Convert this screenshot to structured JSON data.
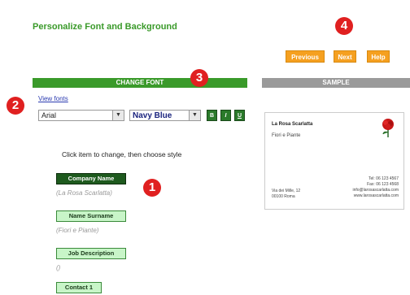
{
  "page": {
    "title": "Personalize Font and Background"
  },
  "nav": {
    "previous": "Previous",
    "next": "Next",
    "help": "Help"
  },
  "markers": {
    "one": "1",
    "two": "2",
    "three": "3",
    "four": "4"
  },
  "font_panel": {
    "header": "CHANGE FONT",
    "view_fonts": "View fonts",
    "font_value": "Arial",
    "color_value": "Navy Blue",
    "bold": "B",
    "italic": "I",
    "underline": "U",
    "instruction": "Click item to change, then choose style"
  },
  "items": [
    {
      "label": "Company Name",
      "value": "(La Rosa Scarlatta)"
    },
    {
      "label": "Name Surname",
      "value": "(Fiori e Piante)"
    },
    {
      "label": "Job Description",
      "value": "()"
    },
    {
      "label": "Contact 1",
      "value": ""
    }
  ],
  "sample": {
    "header": "SAMPLE",
    "company": "La Rosa Scarlatta",
    "subtitle": "Fiori e Piante",
    "address_lines": [
      "Via dei Mille, 12",
      "00100 Roma"
    ],
    "contact_lines": [
      "Tel: 06 123 4567",
      "Fax: 06 123 4568",
      "info@larosascarlatta.com",
      "www.larosascarlatta.com"
    ]
  },
  "colors": {
    "green": "#3a9a2a",
    "orange": "#f5a020",
    "gray": "#9a9a9a",
    "red": "#e02020"
  }
}
